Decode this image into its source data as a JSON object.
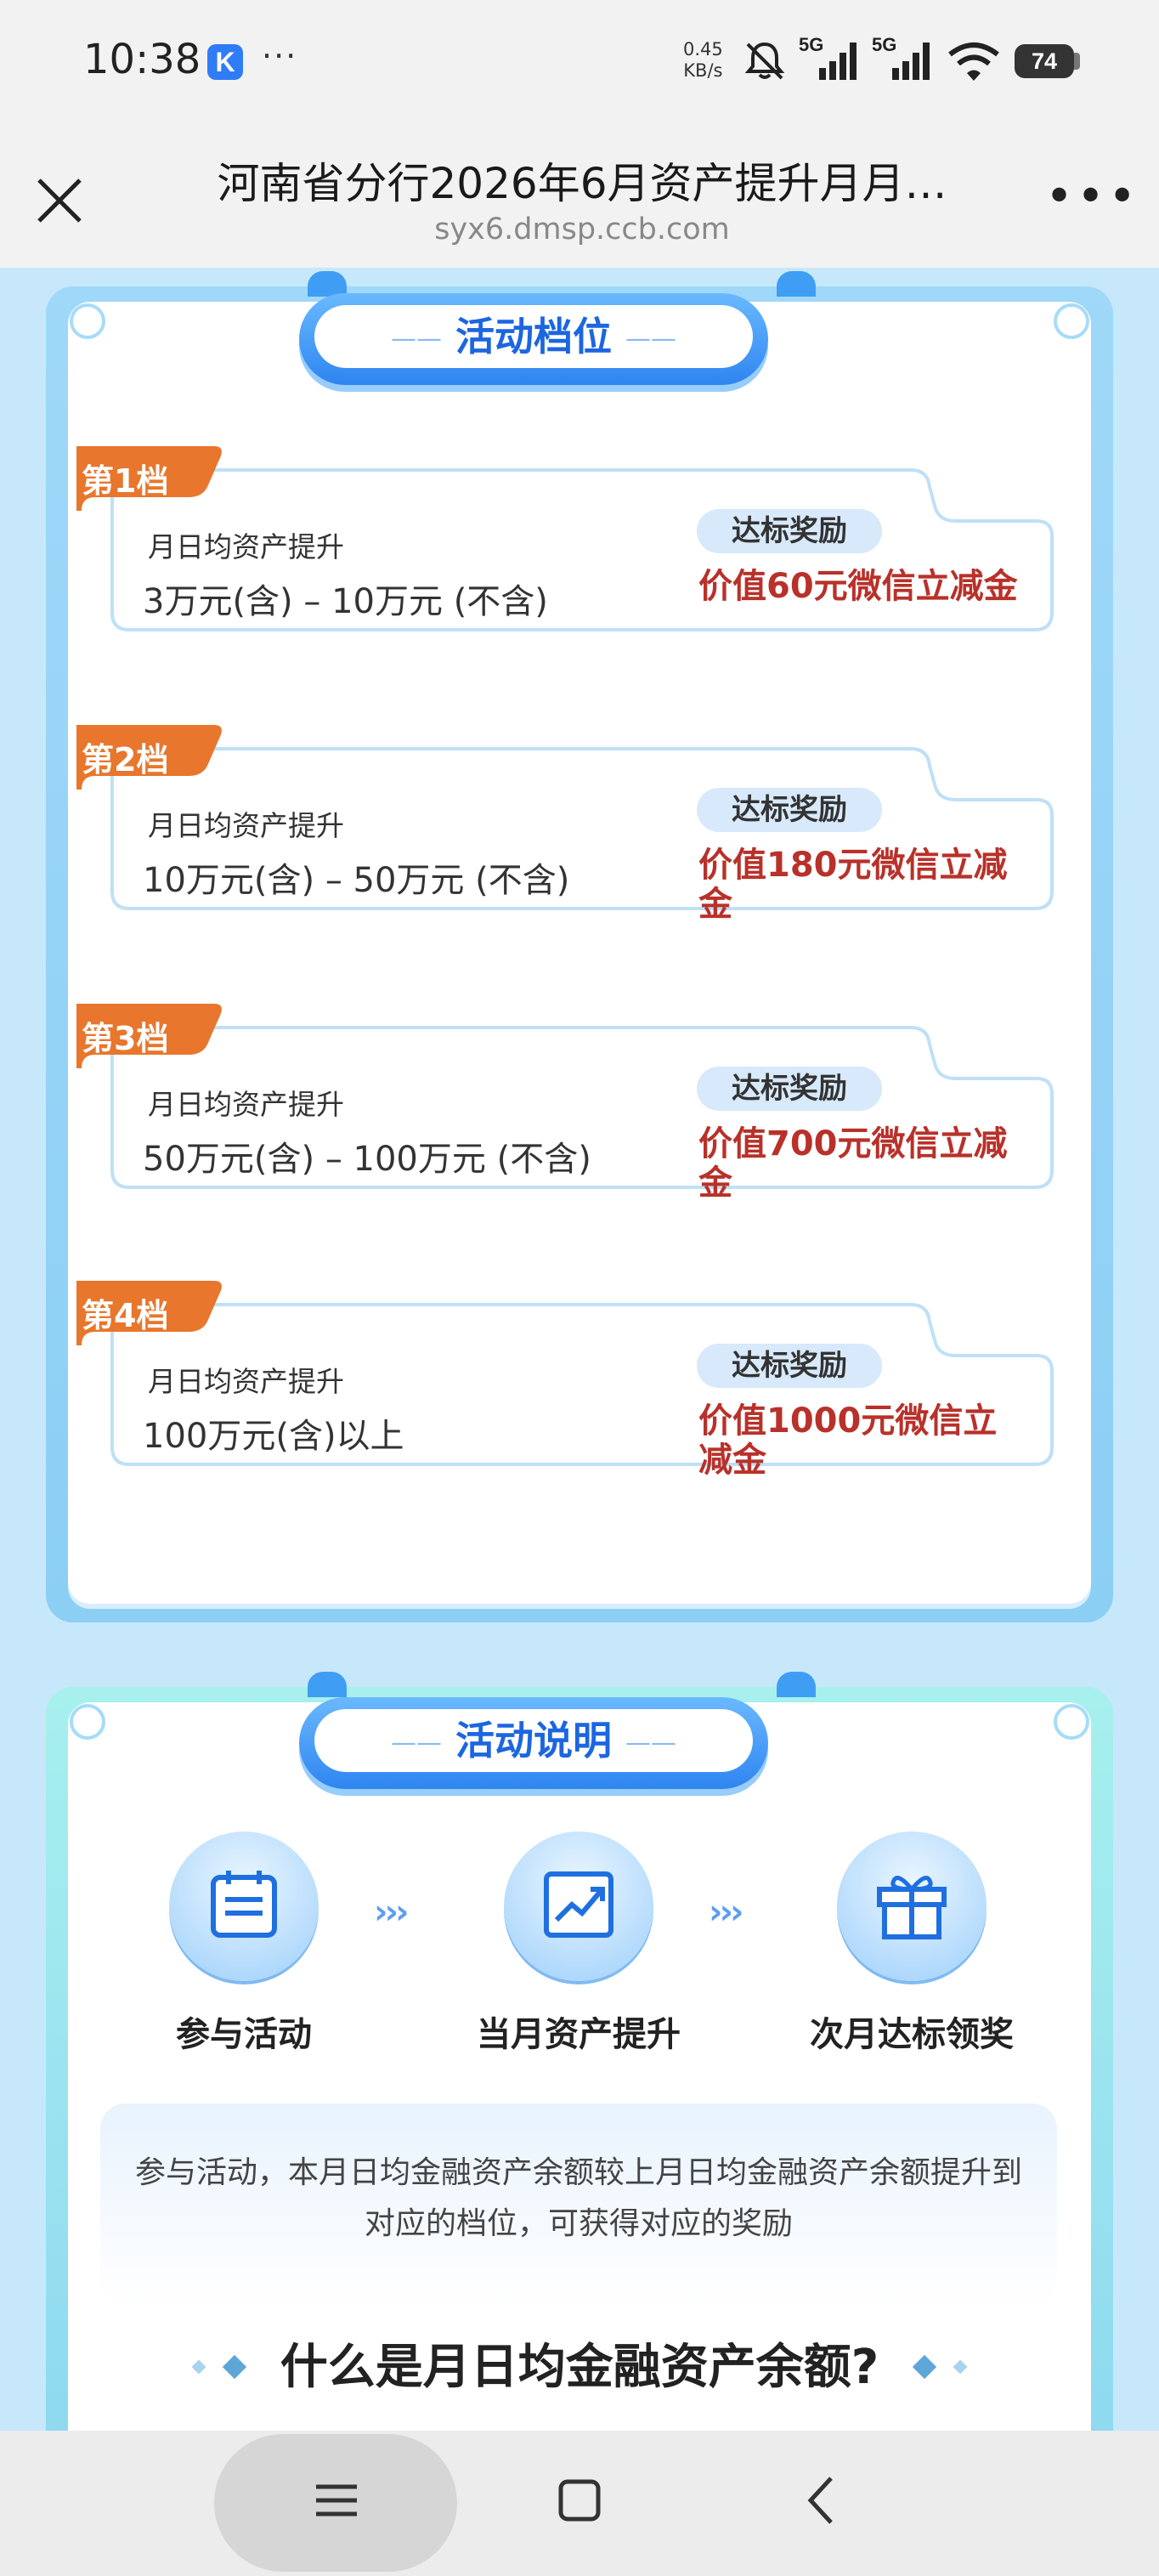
{
  "status_bar": {
    "time": "10:38",
    "app_badge": "K",
    "more": "···",
    "net_speed_value": "0.45",
    "net_speed_unit": "KB/s",
    "signal_1_label": "5G",
    "signal_2_label": "5G",
    "battery": "74"
  },
  "nav": {
    "title": "河南省分行2026年6月资产提升月月…",
    "url": "syx6.dmsp.ccb.com",
    "menu": "•••"
  },
  "tiers_panel": {
    "heading": "活动档位",
    "tiers": [
      {
        "badge": "第1档",
        "subtitle": "月日均资产提升",
        "range": "3万元(含) – 10万元 (不含)",
        "reward_label": "达标奖励",
        "reward": "价值60元微信立减金"
      },
      {
        "badge": "第2档",
        "subtitle": "月日均资产提升",
        "range": "10万元(含) – 50万元 (不含)",
        "reward_label": "达标奖励",
        "reward": "价值180元微信立减金"
      },
      {
        "badge": "第3档",
        "subtitle": "月日均资产提升",
        "range": "50万元(含) – 100万元 (不含)",
        "reward_label": "达标奖励",
        "reward": "价值700元微信立减金"
      },
      {
        "badge": "第4档",
        "subtitle": "月日均资产提升",
        "range": "100万元(含)以上",
        "reward_label": "达标奖励",
        "reward": "价值1000元微信立减金"
      }
    ]
  },
  "explain_panel": {
    "heading": "活动说明",
    "steps": [
      {
        "label": "参与活动",
        "icon": "calendar-icon"
      },
      {
        "label": "当月资产提升",
        "icon": "chart-up-icon"
      },
      {
        "label": "次月达标领奖",
        "icon": "gift-icon"
      }
    ],
    "arrows": "›››",
    "description": "参与活动，本月日均金融资产余额较上月日均金融资产余额提升到对应的档位，可获得对应的奖励",
    "question": "什么是月日均金融资产余额?"
  },
  "colors": {
    "accent_blue": "#2f85f0",
    "reward_red": "#b8312a",
    "badge_orange": "#e8762c"
  }
}
